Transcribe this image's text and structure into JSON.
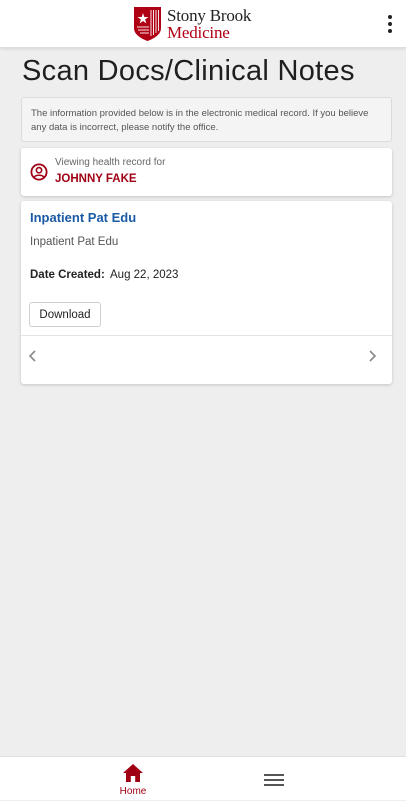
{
  "header": {
    "brand_line1": "Stony Brook",
    "brand_line2": "Medicine",
    "logo_icon": "stony-brook-shield",
    "menu_icon": "more-vertical-icon"
  },
  "page": {
    "title": "Scan Docs/Clinical Notes"
  },
  "notice": {
    "text": "The information provided below is in the electronic medical record. If you believe any data is incorrect, please notify the office."
  },
  "patient": {
    "caption": "Viewing health record for",
    "name": "JOHNNY FAKE",
    "icon": "user-circle-icon"
  },
  "document": {
    "title": "Inpatient Pat Edu",
    "subtitle": "Inpatient Pat Edu",
    "date_label": "Date Created:",
    "date_value": "Aug 22, 2023",
    "download_label": "Download"
  },
  "bottom_nav": {
    "home_label": "Home",
    "menu_icon": "hamburger-menu-icon"
  },
  "colors": {
    "brand_red": "#a00014",
    "link_blue": "#1a5aa6",
    "background": "#eeeeee"
  }
}
